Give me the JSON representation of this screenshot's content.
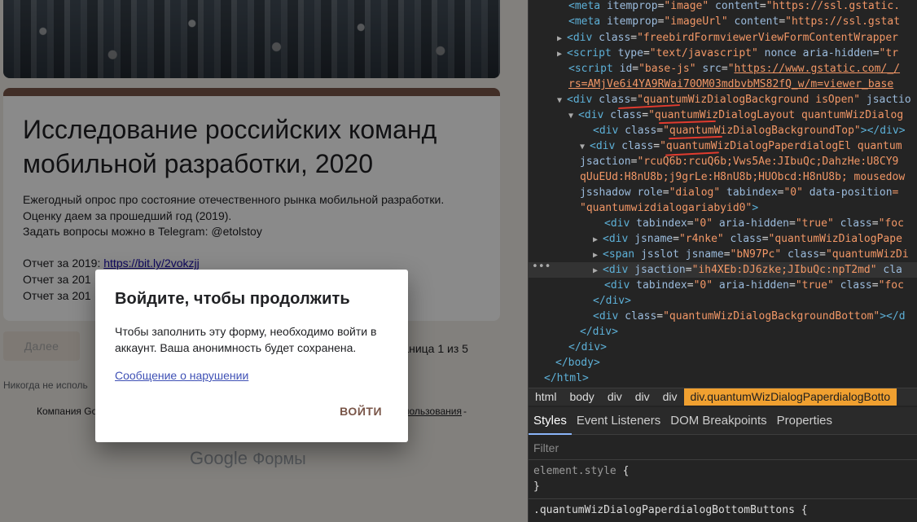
{
  "form": {
    "title_line1": "Исследование российских команд",
    "title_line2": "мобильной разработки, 2020",
    "desc1": "Ежегодный опрос про состояние отечественного рынка мобильной разработки.",
    "desc2": "Оценку даем за прошедший год (2019).",
    "desc3": "Задать вопросы можно в Telegram: @etolstoy",
    "report2019_prefix": "Отчет за 2019: ",
    "report2019_link": "https://bit.ly/2vokzjj",
    "report2018_prefix": "Отчет за 201",
    "report2017_prefix": "Отчет за 201",
    "next_label": "Далее",
    "page_indicator": "Страница 1 из 5",
    "never_note": "Никогда не исполь",
    "company_line": "Компания Go",
    "terms_link": "спользования",
    "terms_dash": " -",
    "logo_google": "Google",
    "logo_forms": "Формы",
    "accent_color": "#795548"
  },
  "dialog": {
    "title": "Войдите, чтобы продолжить",
    "body": "Чтобы заполнить эту форму, необходимо войти в аккаунт. Ваша анонимность будет сохранена.",
    "report_link": "Сообщение о нарушении",
    "login_label": "ВОЙТИ"
  },
  "devtools": {
    "lines": {
      "l1": {
        "pre": "<",
        "tag": "meta",
        "a1": " itemprop",
        "v1": "\"image\"",
        "a2": " content",
        "v2": "\"https://ssl.gstatic."
      },
      "l2": {
        "pre": "<",
        "tag": "meta",
        "a1": " itemprop",
        "v1": "\"imageUrl\"",
        "a2": " content",
        "v2": "\"https://ssl.gstat"
      },
      "l3": {
        "tag": "div",
        "a1": " class",
        "v1": "\"freebirdFormviewerViewFormContentWrapper"
      },
      "l4": {
        "tag": "script",
        "a1": " type",
        "v1": "\"text/javascript\"",
        "a2": " nonce aria-hidden",
        "v2": "\"tr"
      },
      "l5": {
        "tag": "script",
        "a1": " id",
        "v1": "\"base-js\"",
        "a2": " src",
        "v2": "\"",
        "link": "https://www.gstatic.com/_/"
      },
      "l6": {
        "link": "rs=AMjVe6i4YA9RWai70OM03mdbvbMS82fQ_w/m=viewer_base"
      },
      "l7": {
        "tag": "div",
        "a1": " class",
        "v1": "\"quantumWizDialogBackground isOpen\"",
        "a2": " jsactio"
      },
      "l8": {
        "tag": "div",
        "a1": " class",
        "v1": "\"quantumWizDialogLayout quantumWizDialog"
      },
      "l9": {
        "tag": "div",
        "a1": " class",
        "v1": "\"quantumWizDialogBackgroundTop\"",
        "close": "></div>"
      },
      "l10": {
        "tag": "div",
        "a1": " class",
        "v1": "\"quantumWizDialogPaperdialogEl quantum"
      },
      "l11": {
        "a1": "jsaction",
        "v1": "\"rcuQ6b:rcuQ6b;Vws5Ae:JIbuQc;DahzHe:U8CY9"
      },
      "l12": {
        "v1": "qUuEUd:H8nU8b;j9grLe:H8nU8b;HUObcd:H8nU8b; mousedow"
      },
      "l13": {
        "a1": "jsshadow role",
        "v1": "\"dialog\"",
        "a2": " tabindex",
        "v2": "\"0\"",
        "a3": " data-position",
        "v3": "="
      },
      "l14": {
        "v1": "\"quantumwizdialogariabyid0\"",
        "close": ">"
      },
      "l15": {
        "tag": "div",
        "a1": " tabindex",
        "v1": "\"0\"",
        "a2": " aria-hidden",
        "v2": "\"true\"",
        "a3": " class",
        "v3": "\"foc"
      },
      "l16": {
        "tag": "div",
        "a1": " jsname",
        "v1": "\"r4nke\"",
        "a2": " class",
        "v2": "\"quantumWizDialogPape"
      },
      "l17": {
        "tag": "span",
        "a1": " jsslot jsname",
        "v1": "\"bN97Pc\"",
        "a2": " class",
        "v2": "\"quantumWizDi"
      },
      "l18": {
        "tag": "div",
        "a1": " jsaction",
        "v1": "\"ih4XEb:DJ6zke;JIbuQc:npT2md\"",
        "a2": " cla"
      },
      "l19": {
        "tag": "div",
        "a1": " tabindex",
        "v1": "\"0\"",
        "a2": " aria-hidden",
        "v2": "\"true\"",
        "a3": " class",
        "v3": "\"foc"
      },
      "l20": {
        "text": "</div>"
      },
      "l21": {
        "tag": "div",
        "a1": " class",
        "v1": "\"quantumWizDialogBackgroundBottom\"",
        "close": "></d"
      },
      "l22": {
        "text": "</div>"
      },
      "l23": {
        "text": "</div>"
      },
      "l24": {
        "text": "</body>"
      },
      "l25": {
        "text": "</html>"
      }
    },
    "breadcrumbs": [
      "html",
      "body",
      "div",
      "div",
      "div",
      "div.quantumWizDialogPaperdialogBotto"
    ],
    "subtabs": [
      "Styles",
      "Event Listeners",
      "DOM Breakpoints",
      "Properties"
    ],
    "filter_placeholder": "Filter",
    "style_element": "element.style",
    "brace_open": " {",
    "brace_close": "}",
    "style_rule_selector": ".quantumWizDialogPaperdialogBottomButtons"
  }
}
